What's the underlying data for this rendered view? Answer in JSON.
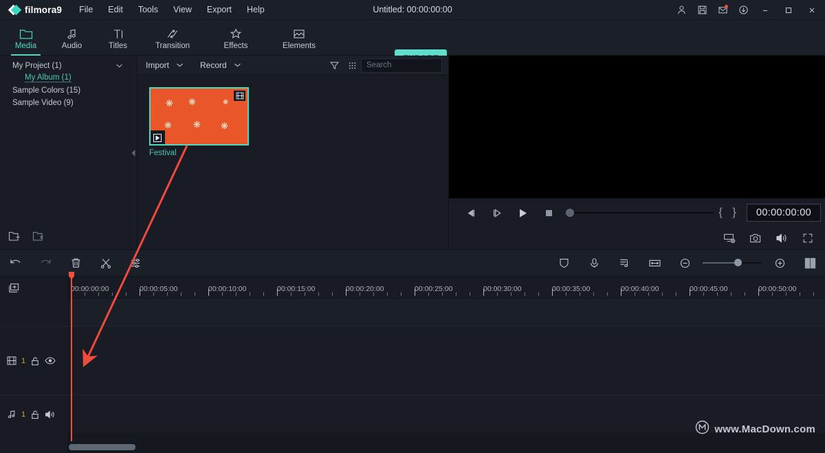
{
  "app": {
    "brand": "filmora9",
    "title": "Untitled:  00:00:00:00",
    "accent": "#4fd8c0",
    "export_accent": "#5fdecb",
    "playhead_color": "#f0513c",
    "annotation_color": "#ef4b3c"
  },
  "menubar": {
    "items": [
      {
        "label": "File"
      },
      {
        "label": "Edit"
      },
      {
        "label": "Tools"
      },
      {
        "label": "View"
      },
      {
        "label": "Export"
      },
      {
        "label": "Help"
      }
    ]
  },
  "titlebar_icons": [
    {
      "name": "account-icon",
      "title": "Account"
    },
    {
      "name": "save-icon",
      "title": "Save"
    },
    {
      "name": "mail-icon",
      "title": "Messages",
      "badge": true
    },
    {
      "name": "download-icon",
      "title": "Download"
    }
  ],
  "window_controls": [
    {
      "name": "minimize-button",
      "glyph": "minimize"
    },
    {
      "name": "maximize-button",
      "glyph": "maximize"
    },
    {
      "name": "close-button",
      "glyph": "close"
    }
  ],
  "tabs": [
    {
      "label": "Media",
      "icon": "folder-icon",
      "active": true
    },
    {
      "label": "Audio",
      "icon": "music-note-icon",
      "active": false
    },
    {
      "label": "Titles",
      "icon": "text-icon",
      "active": false
    },
    {
      "label": "Transition",
      "icon": "transition-icon",
      "active": false
    },
    {
      "label": "Effects",
      "icon": "sparkle-icon",
      "active": false
    },
    {
      "label": "Elements",
      "icon": "image-icon",
      "active": false
    }
  ],
  "toolbar": {
    "export_label": "EXPORT"
  },
  "library": {
    "items": [
      {
        "label": "My Project (1)",
        "indent": false,
        "selected": false,
        "chevron": true
      },
      {
        "label": "My Album (1)",
        "indent": true,
        "selected": true,
        "chevron": false
      },
      {
        "label": "Sample Colors (15)",
        "indent": false,
        "selected": false,
        "chevron": false
      },
      {
        "label": "Sample Video (9)",
        "indent": false,
        "selected": false,
        "chevron": false
      }
    ],
    "footer": [
      {
        "name": "new-folder-icon",
        "title": "New folder"
      },
      {
        "name": "delete-folder-icon",
        "title": "Delete folder"
      }
    ]
  },
  "media_toolbar": {
    "import_label": "Import",
    "record_label": "Record",
    "filter_icon": "filter-icon",
    "grid_icon": "grid-view-icon",
    "search_placeholder": "Search",
    "search_value": ""
  },
  "media_items": [
    {
      "label": "Festival",
      "selected": true,
      "badge_icon": "film-icon",
      "play_icon": "play-icon"
    }
  ],
  "player": {
    "controls": [
      {
        "name": "prev-frame-button",
        "icon": "prev-frame-icon"
      },
      {
        "name": "next-frame-button",
        "icon": "next-frame-icon"
      },
      {
        "name": "play-button",
        "icon": "play-icon"
      },
      {
        "name": "stop-button",
        "icon": "stop-icon"
      }
    ],
    "mark_in": "{",
    "mark_out": "}",
    "timecode": "00:00:00:00",
    "progress_percent": 0,
    "secondary_controls": [
      {
        "name": "display-settings-icon",
        "title": "Display settings"
      },
      {
        "name": "snapshot-icon",
        "title": "Snapshot"
      },
      {
        "name": "volume-icon",
        "title": "Volume"
      },
      {
        "name": "fullscreen-icon",
        "title": "Full screen"
      }
    ]
  },
  "timeline_toolbar": {
    "left": [
      {
        "name": "undo-button",
        "icon": "undo-icon",
        "disabled": false
      },
      {
        "name": "redo-button",
        "icon": "redo-icon",
        "disabled": true
      },
      {
        "name": "delete-button",
        "icon": "trash-icon",
        "disabled": false
      },
      {
        "name": "split-button",
        "icon": "scissors-icon",
        "disabled": false
      },
      {
        "name": "settings-button",
        "icon": "sliders-icon",
        "disabled": false
      }
    ],
    "right": [
      {
        "name": "color-correct-button",
        "icon": "shield-icon"
      },
      {
        "name": "voiceover-button",
        "icon": "microphone-icon"
      },
      {
        "name": "audio-mixer-button",
        "icon": "audio-mixer-icon"
      },
      {
        "name": "fit-timeline-button",
        "icon": "fit-width-icon"
      },
      {
        "name": "zoom-out-button",
        "icon": "minus-circle-icon"
      },
      {
        "name": "zoom-in-button",
        "icon": "plus-circle-icon"
      },
      {
        "name": "split-view-button",
        "icon": "panels-icon"
      }
    ],
    "zoom_percent": 54
  },
  "ruler": {
    "labels": [
      "00:00:00:00",
      "00:00:05:00",
      "00:00:10:00",
      "00:00:15:00",
      "00:00:20:00",
      "00:00:25:00",
      "00:00:30:00",
      "00:00:35:00",
      "00:00:40:00",
      "00:00:45:00",
      "00:00:50:00"
    ]
  },
  "tracks": [
    {
      "type": "video",
      "number": "1",
      "type_icon": "film-track-icon",
      "lock_icon": "unlock-icon",
      "visibility_icon": "eye-icon"
    },
    {
      "type": "audio",
      "number": "1",
      "type_icon": "music-note-icon",
      "lock_icon": "unlock-icon",
      "visibility_icon": "speaker-icon"
    }
  ],
  "add_track": {
    "name": "add-track-icon",
    "title": "Add track"
  },
  "watermark": {
    "text": "www.MacDown.com",
    "logo": "circled-m-logo"
  }
}
